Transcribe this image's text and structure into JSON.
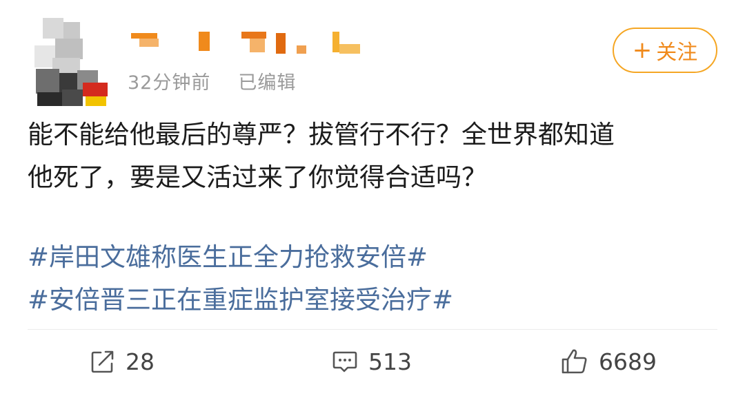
{
  "post": {
    "meta": {
      "time": "32分钟前",
      "edited": "已编辑"
    },
    "follow_label": "关注",
    "body_line1": "能不能给他最后的尊严？拔管行不行？全世界都知道",
    "body_line2": "他死了，要是又活过来了你觉得合适吗？",
    "hashtags": [
      "#岸田文雄称医生正全力抢救安倍#",
      "#安倍晋三正在重症监护室接受治疗#"
    ],
    "actions": {
      "share_count": "28",
      "comment_count": "513",
      "like_count": "6689"
    }
  },
  "colors": {
    "accent": "#f08a1c",
    "hashtag": "#4a6d9c",
    "meta": "#9a9a9a"
  },
  "icons": [
    "share-icon",
    "comment-icon",
    "like-icon",
    "plus-icon"
  ]
}
